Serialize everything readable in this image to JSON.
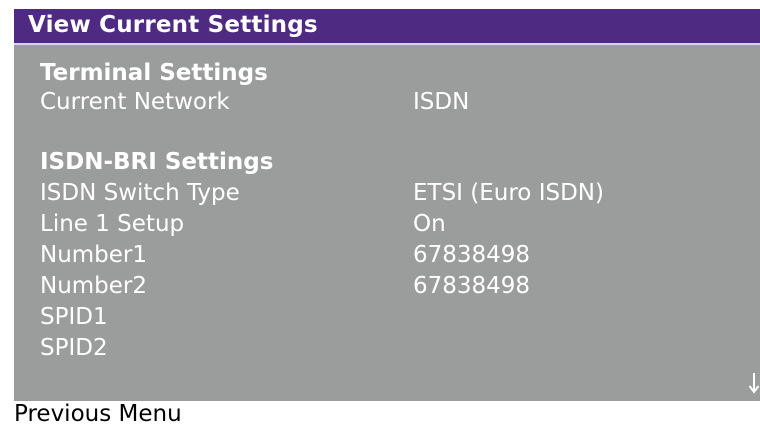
{
  "window": {
    "title": "View Current Settings"
  },
  "sections": [
    {
      "heading": "Terminal Settings",
      "rows": [
        {
          "label": "Current Network",
          "value": "ISDN"
        }
      ]
    },
    {
      "heading": "ISDN-BRI Settings",
      "rows": [
        {
          "label": "ISDN Switch Type",
          "value": "ETSI (Euro ISDN)"
        },
        {
          "label": "Line 1 Setup",
          "value": "On"
        },
        {
          "label": "Number1",
          "value": "67838498"
        },
        {
          "label": "Number2",
          "value": "67838498"
        },
        {
          "label": "SPID1",
          "value": ""
        },
        {
          "label": "SPID2",
          "value": ""
        }
      ]
    }
  ],
  "footer": {
    "previous_menu_label": "Previous Menu"
  },
  "icons": {
    "scroll": "down-arrow-icon"
  },
  "colors": {
    "title_bar": "#4e2a82",
    "panel": "#9b9c9c",
    "text": "#ffffff"
  }
}
